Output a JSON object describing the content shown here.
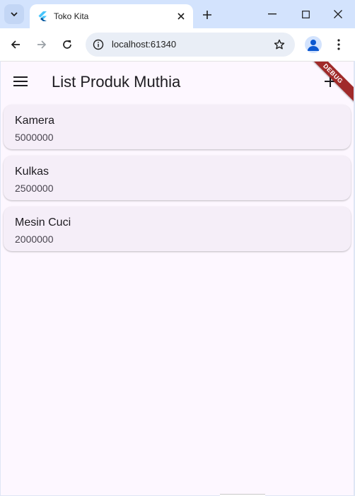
{
  "browser": {
    "tab_title": "Toko Kita",
    "url": "localhost:61340"
  },
  "app": {
    "title": "List Produk Muthia",
    "debug_banner": "DEBUG",
    "products": [
      {
        "name": "Kamera",
        "price": "5000000"
      },
      {
        "name": "Kulkas",
        "price": "2500000"
      },
      {
        "name": "Mesin Cuci",
        "price": "2000000"
      }
    ]
  },
  "colors": {
    "tabstrip": "#d3e3fd",
    "app_background": "#fdf7ff",
    "card": "#f5eef8",
    "debug": "#a02a2a"
  }
}
